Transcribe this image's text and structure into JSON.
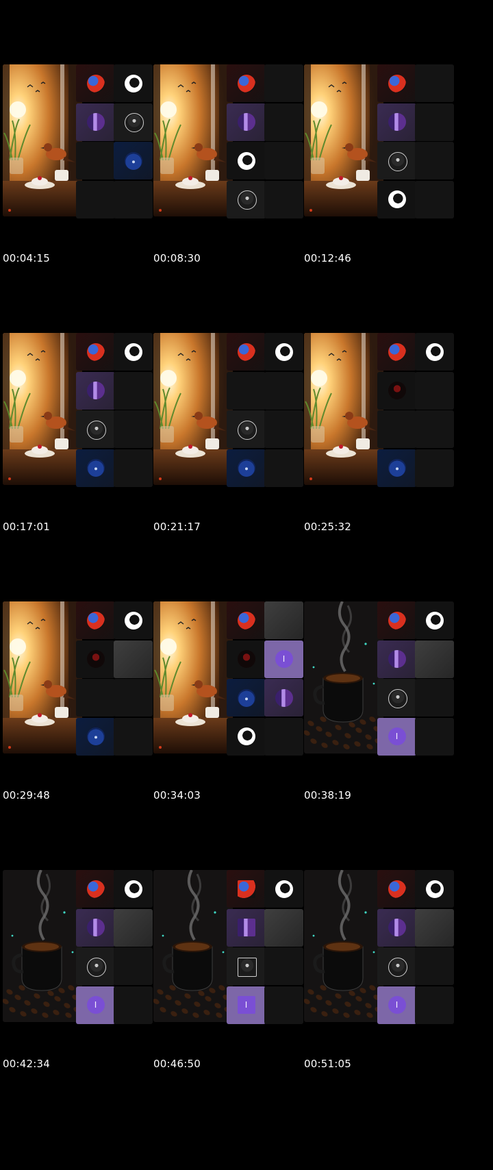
{
  "frames": [
    {
      "timestamp": "00:04:15",
      "scene": "bird",
      "tiles": [
        "red",
        "white",
        "purple",
        "person",
        "empty",
        "blue",
        "empty",
        "empty"
      ]
    },
    {
      "timestamp": "00:08:30",
      "scene": "bird",
      "tiles": [
        "red",
        "empty",
        "purple",
        "empty",
        "white",
        "empty",
        "person",
        "empty"
      ]
    },
    {
      "timestamp": "00:12:46",
      "scene": "bird",
      "tiles": [
        "red",
        "empty",
        "purple",
        "empty",
        "person",
        "empty",
        "white",
        "empty"
      ]
    },
    {
      "timestamp": "00:17:01",
      "scene": "bird",
      "tiles": [
        "red",
        "white",
        "purple",
        "empty",
        "person",
        "empty",
        "blue",
        "empty"
      ]
    },
    {
      "timestamp": "00:21:17",
      "scene": "bird",
      "tiles": [
        "red",
        "white",
        "empty",
        "empty",
        "person",
        "empty",
        "blue",
        "empty"
      ]
    },
    {
      "timestamp": "00:25:32",
      "scene": "bird",
      "tiles": [
        "red",
        "white",
        "darkred",
        "empty",
        "empty",
        "empty",
        "blue",
        "empty"
      ]
    },
    {
      "timestamp": "00:29:48",
      "scene": "bird",
      "tiles": [
        "red",
        "white",
        "darkred",
        "light",
        "empty",
        "empty",
        "blue",
        "empty"
      ]
    },
    {
      "timestamp": "00:34:03",
      "scene": "bird",
      "tiles": [
        "red",
        "light",
        "darkred",
        "disc",
        "blue",
        "purple",
        "white",
        "empty"
      ]
    },
    {
      "timestamp": "00:38:19",
      "scene": "coffee",
      "tiles": [
        "red",
        "white",
        "purple",
        "light",
        "person",
        "empty",
        "disc",
        "empty"
      ]
    },
    {
      "timestamp": "00:42:34",
      "scene": "coffee",
      "tiles": [
        "red",
        "white",
        "purple",
        "light",
        "person",
        "empty",
        "disc",
        "empty"
      ]
    },
    {
      "timestamp": "00:46:50",
      "scene": "coffee",
      "tiles": [
        "red-sq",
        "white",
        "purple-sq",
        "light-sq",
        "person-sq",
        "empty",
        "disc-sq",
        "empty"
      ]
    },
    {
      "timestamp": "00:51:05",
      "scene": "coffee",
      "tiles": [
        "red",
        "white",
        "purple",
        "light",
        "person",
        "empty",
        "disc",
        "empty"
      ]
    }
  ],
  "disc_letter": "I"
}
